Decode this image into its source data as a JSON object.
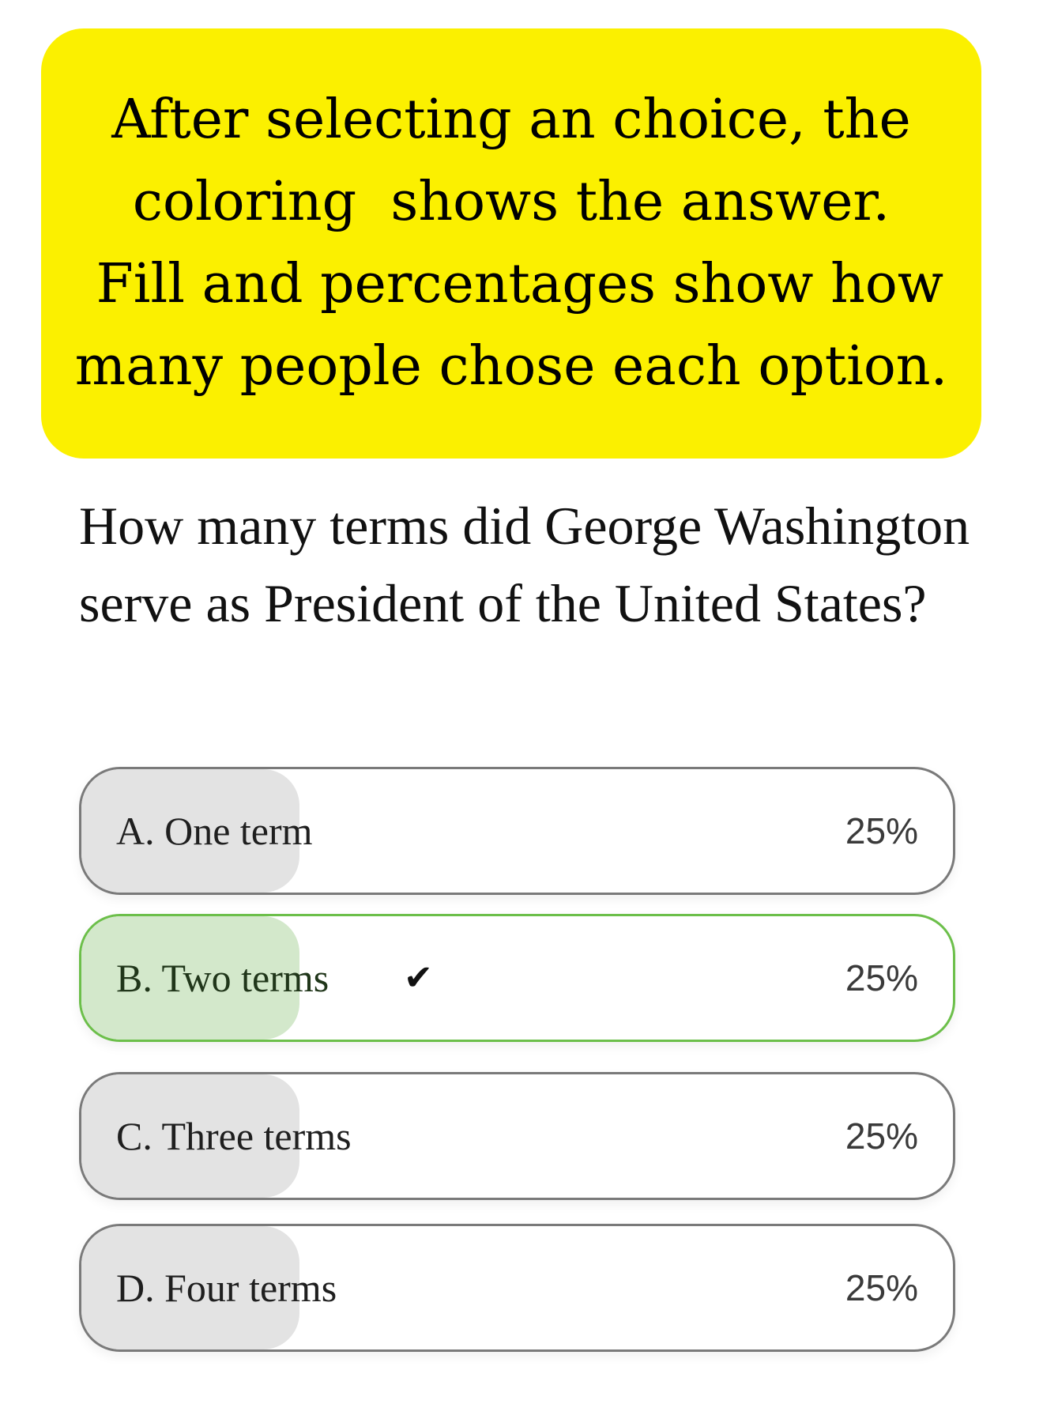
{
  "banner": {
    "lines": [
      "After selecting an choice, the",
      "coloring  shows the answer.",
      " Fill and percentages show how",
      "many people chose each option."
    ],
    "color": "#fbf000"
  },
  "question": {
    "text": "How many terms did George Washington serve as President of the United States?"
  },
  "options": [
    {
      "label": "A. One term",
      "percent": "25%",
      "fill_fraction": 0.25,
      "correct": false,
      "check": ""
    },
    {
      "label": "B. Two terms",
      "percent": "25%",
      "fill_fraction": 0.25,
      "correct": true,
      "check": "✔"
    },
    {
      "label": "C. Three terms",
      "percent": "25%",
      "fill_fraction": 0.25,
      "correct": false,
      "check": ""
    },
    {
      "label": "D. Four terms",
      "percent": "25%",
      "fill_fraction": 0.25,
      "correct": false,
      "check": ""
    }
  ],
  "colors": {
    "correct_border": "#6cbf4a",
    "correct_fill": "#d3e8cb",
    "neutral_fill": "#e3e3e3"
  }
}
